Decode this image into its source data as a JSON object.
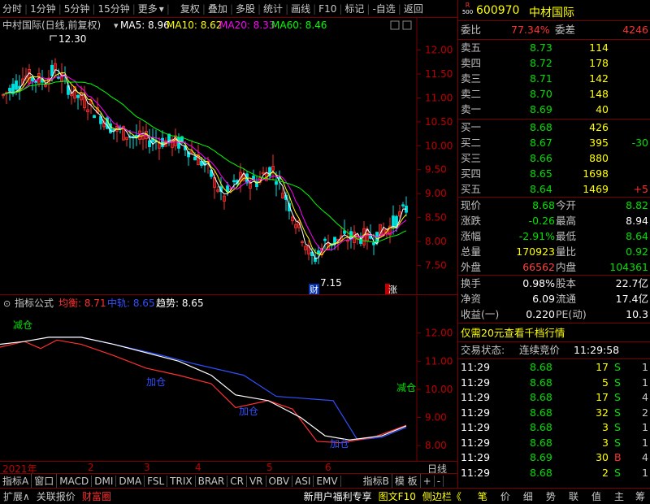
{
  "toolbar": {
    "items": [
      "分时",
      "1分钟",
      "5分钟",
      "15分钟",
      "更多",
      "复权",
      "叠加",
      "多股",
      "统计",
      "画线",
      "F10",
      "标记",
      "-自选",
      "返回"
    ],
    "more_arrow": "▾"
  },
  "main_chart": {
    "title": "中村国际(日线,前复权)",
    "ma": [
      {
        "label": "MA5: 8.96",
        "color": "#ffffff"
      },
      {
        "label": "MA10: 8.62",
        "color": "#ffff00"
      },
      {
        "label": "MA20: 8.33",
        "color": "#ff00ff"
      },
      {
        "label": "MA60: 8.46",
        "color": "#00ff00"
      }
    ],
    "yticks": [
      "12.00",
      "11.50",
      "11.00",
      "10.50",
      "10.00",
      "9.50",
      "9.00",
      "8.50",
      "8.00",
      "7.50"
    ],
    "high_label": "12.30",
    "low_label": "7.15",
    "marker_cai": "财",
    "marker_zhang": "涨"
  },
  "ind_chart": {
    "name": "指标公式",
    "legend": [
      {
        "label": "均衡: 8.71",
        "color": "#ff3030"
      },
      {
        "label": "中轨: 8.65",
        "color": "#3050ff"
      },
      {
        "label": "趋势: 8.65",
        "color": "#ffffff"
      }
    ],
    "yticks": [
      "12.00",
      "11.00",
      "10.00",
      "9.00",
      "8.00"
    ],
    "labels": [
      "减仓",
      "加仓",
      "加仓",
      "加仓",
      "减仓"
    ]
  },
  "time_axis": [
    "2021年",
    "2",
    "3",
    "4",
    "5",
    "6"
  ],
  "time_axis_right": "日线",
  "tabs": [
    "指标A",
    "窗口",
    "MACD",
    "DMI",
    "DMA",
    "FSL",
    "TRIX",
    "BRAR",
    "CR",
    "VR",
    "OBV",
    "ASI",
    "EMV",
    "指标B",
    "模 板",
    "+",
    "-"
  ],
  "bottom": [
    "扩展∧",
    "关联报价",
    "财富圈",
    "新用户福利专享",
    "图文F10",
    "侧边栏《",
    "笔",
    "价",
    "细",
    "势",
    "联",
    "值",
    "主",
    "筹"
  ],
  "quote": {
    "badge_r": "R",
    "badge_num": "500",
    "code": "600970",
    "name": "中材国际",
    "weibi_label": "委比",
    "weibi": "77.34%",
    "weicha_label": "委差",
    "weicha": "4246",
    "asks": [
      {
        "label": "卖五",
        "price": "8.73",
        "vol": "114"
      },
      {
        "label": "卖四",
        "price": "8.72",
        "vol": "178"
      },
      {
        "label": "卖三",
        "price": "8.71",
        "vol": "142"
      },
      {
        "label": "卖二",
        "price": "8.70",
        "vol": "148"
      },
      {
        "label": "卖一",
        "price": "8.69",
        "vol": "40"
      }
    ],
    "bids": [
      {
        "label": "买一",
        "price": "8.68",
        "vol": "426",
        "chg": ""
      },
      {
        "label": "买二",
        "price": "8.67",
        "vol": "395",
        "chg": "-30"
      },
      {
        "label": "买三",
        "price": "8.66",
        "vol": "880",
        "chg": ""
      },
      {
        "label": "买四",
        "price": "8.65",
        "vol": "1698",
        "chg": ""
      },
      {
        "label": "买五",
        "price": "8.64",
        "vol": "1469",
        "chg": "+5"
      }
    ],
    "stats": [
      {
        "l1": "现价",
        "v1": "8.68",
        "l2": "今开",
        "v2": "8.82",
        "c1": "#00e000",
        "c2": "#00e000"
      },
      {
        "l1": "涨跌",
        "v1": "-0.26",
        "l2": "最高",
        "v2": "8.94",
        "c1": "#00e000",
        "c2": "#ffffff"
      },
      {
        "l1": "涨幅",
        "v1": "-2.91%",
        "l2": "最低",
        "v2": "8.64",
        "c1": "#00e000",
        "c2": "#00e000"
      },
      {
        "l1": "总量",
        "v1": "170923",
        "l2": "量比",
        "v2": "0.92",
        "c1": "#ffff00",
        "c2": "#00e000"
      },
      {
        "l1": "外盘",
        "v1": "66562",
        "l2": "内盘",
        "v2": "104361",
        "c1": "#ff4040",
        "c2": "#00e000"
      }
    ],
    "stats2": [
      {
        "l1": "换手",
        "v1": "0.98%",
        "l2": "股本",
        "v2": "22.7亿"
      },
      {
        "l1": "净资",
        "v1": "6.09",
        "l2": "流通",
        "v2": "17.4亿"
      },
      {
        "l1": "收益(一)",
        "v1": "0.220",
        "l2": "PE(动)",
        "v2": "10.3"
      }
    ],
    "promo": "仅需20元查看千档行情",
    "trade_status_label": "交易状态:",
    "trade_status": "连续竞价",
    "trade_time": "11:29:58",
    "ticks": [
      {
        "t": "11:29",
        "p": "8.68",
        "v": "17",
        "d": "S",
        "n": "1"
      },
      {
        "t": "11:29",
        "p": "8.68",
        "v": "5",
        "d": "S",
        "n": "1"
      },
      {
        "t": "11:29",
        "p": "8.68",
        "v": "17",
        "d": "S",
        "n": "4"
      },
      {
        "t": "11:29",
        "p": "8.68",
        "v": "32",
        "d": "S",
        "n": "2"
      },
      {
        "t": "11:29",
        "p": "8.68",
        "v": "3",
        "d": "S",
        "n": "1"
      },
      {
        "t": "11:29",
        "p": "8.68",
        "v": "3",
        "d": "S",
        "n": "1"
      },
      {
        "t": "11:29",
        "p": "8.69",
        "v": "30",
        "d": "B",
        "n": "4"
      },
      {
        "t": "11:29",
        "p": "8.68",
        "v": "2",
        "d": "S",
        "n": "1"
      }
    ]
  },
  "colors": {
    "up": "#ff3030",
    "down": "#00e0e0",
    "grid": "#7a0000"
  }
}
